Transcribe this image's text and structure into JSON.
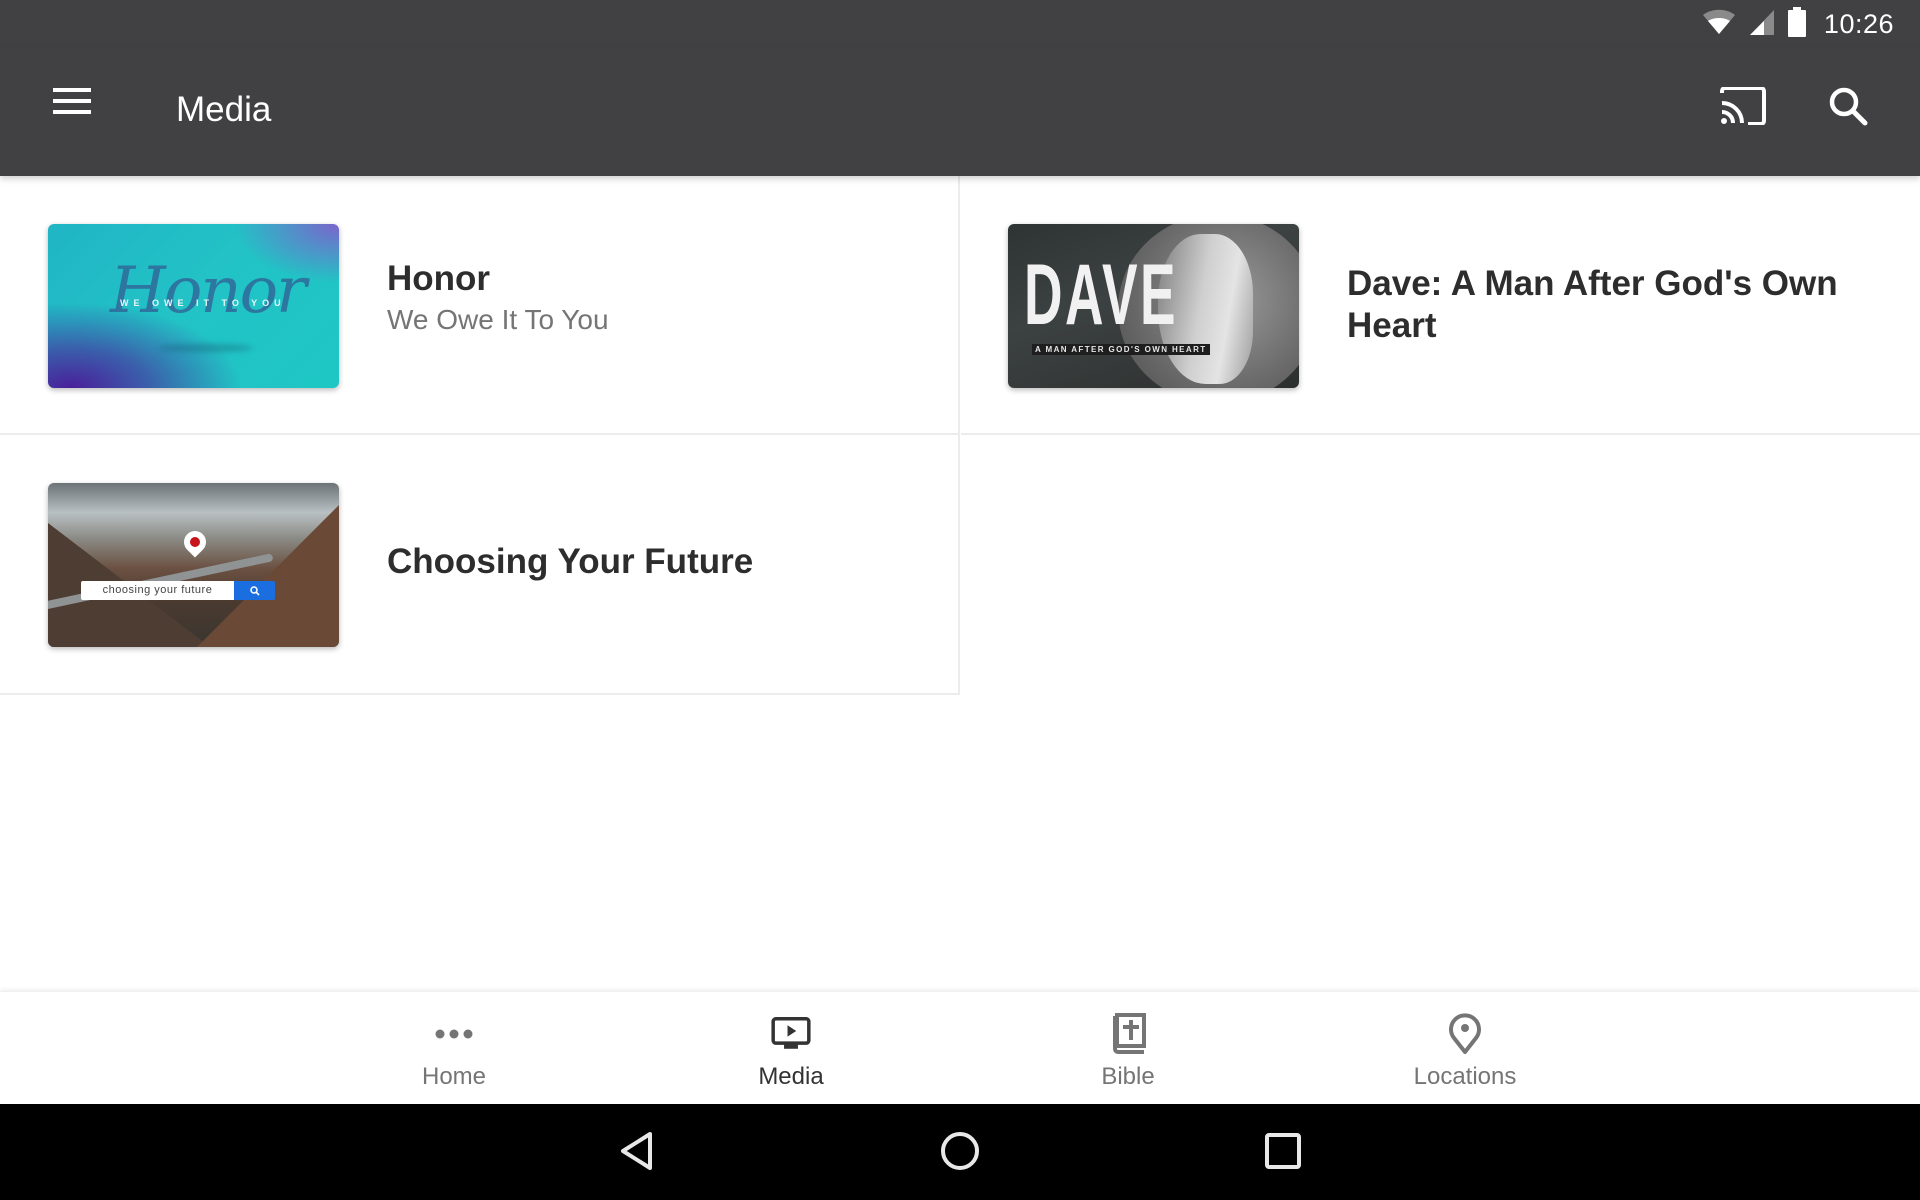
{
  "status_bar": {
    "time": "10:26",
    "icons": [
      "wifi-icon",
      "cell-signal-icon",
      "battery-icon"
    ]
  },
  "toolbar": {
    "menu_icon": "hamburger-menu-icon",
    "title": "Media",
    "actions": [
      {
        "name": "cast",
        "icon": "cast-icon"
      },
      {
        "name": "search",
        "icon": "search-icon"
      }
    ]
  },
  "series": [
    {
      "title": "Honor",
      "subtitle": "We Owe It To You",
      "thumbnail": {
        "art_title": "Honor",
        "art_tagline": "WE OWE IT TO YOU",
        "colors": [
          "#20b5c5",
          "#4a1f9a",
          "#7b64cc"
        ]
      }
    },
    {
      "title": "Dave: A Man After God's Own Heart",
      "subtitle": "",
      "thumbnail": {
        "art_title": "DAVE",
        "art_tagline": "A MAN AFTER GOD'S OWN HEART",
        "colors": [
          "#2e3333",
          "#cfcfcf"
        ]
      }
    },
    {
      "title": "Choosing Your Future",
      "subtitle": "",
      "thumbnail": {
        "search_text": "choosing your future",
        "colors": [
          "#1b6ee0",
          "#c8141b"
        ]
      }
    }
  ],
  "bottom_nav": {
    "items": [
      {
        "label": "Home",
        "icon": "more-dots-icon",
        "active": false
      },
      {
        "label": "Media",
        "icon": "tv-play-icon",
        "active": true
      },
      {
        "label": "Bible",
        "icon": "bible-icon",
        "active": false
      },
      {
        "label": "Locations",
        "icon": "location-pin-icon",
        "active": false
      }
    ],
    "active_color": "#333333",
    "inactive_color": "#757575"
  },
  "system_nav": {
    "buttons": [
      {
        "name": "back",
        "icon": "back-triangle-icon"
      },
      {
        "name": "home",
        "icon": "home-circle-icon"
      },
      {
        "name": "recents",
        "icon": "recents-square-icon"
      }
    ]
  },
  "theme": {
    "toolbar_bg": "#414143",
    "divider": "#ececec",
    "title_text": "#2d2d2d",
    "subtitle_text": "#757575"
  }
}
